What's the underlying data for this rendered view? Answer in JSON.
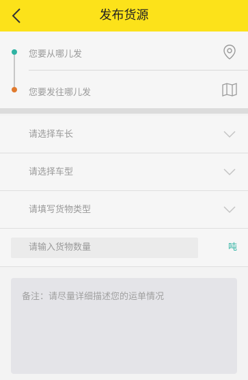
{
  "header": {
    "title": "发布货源",
    "back_icon": "chevron-left-icon",
    "bg_color": "#fce21a"
  },
  "route": {
    "from_placeholder": "您要从哪儿发",
    "to_placeholder": "您要发往哪儿发",
    "from_icon": "location-pin-icon",
    "to_icon": "map-icon",
    "from_dot_color": "#2fb3a3",
    "to_dot_color": "#e07a2e"
  },
  "selects": {
    "vehicle_length": "请选择车长",
    "vehicle_type": "请选择车型",
    "goods_type": "请填写货物类型"
  },
  "quantity": {
    "placeholder": "请输入货物数量",
    "unit": "吨",
    "unit_color": "#2fb3a3"
  },
  "remark": {
    "placeholder": "备注：请尽量详细描述您的运单情况"
  }
}
